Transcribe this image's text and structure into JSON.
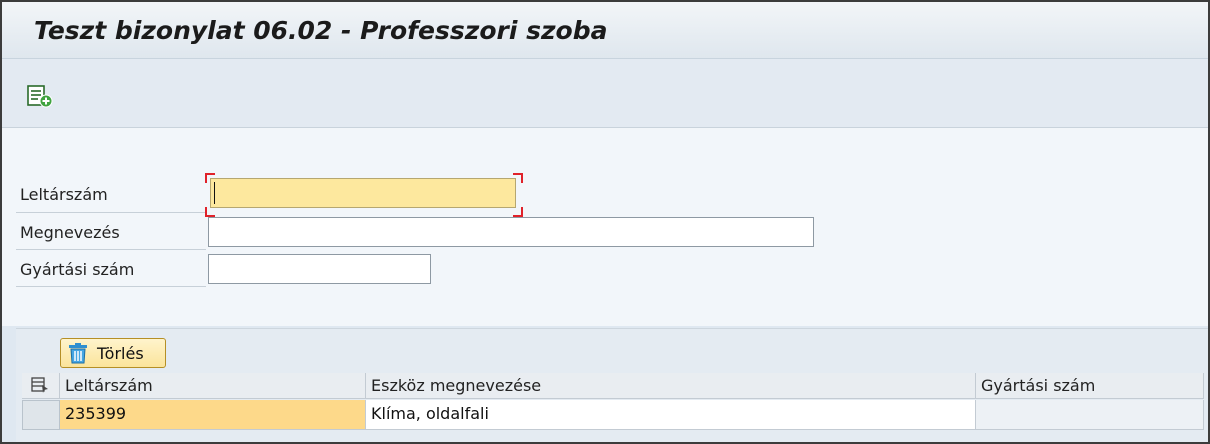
{
  "window": {
    "title": "Teszt bizonylat 06.02 - Professzori szoba"
  },
  "toolbar": {
    "icon": "add-row-icon"
  },
  "form": {
    "inventory_label": "Leltárszám",
    "inventory_value": "",
    "name_label": "Megnevezés",
    "name_value": "",
    "serial_label": "Gyártási szám",
    "serial_value": ""
  },
  "table": {
    "delete_button_label": "Törlés",
    "delete_icon": "trash-icon",
    "columns": [
      "Leltárszám",
      "Eszköz megnevezése",
      "Gyártási szám"
    ],
    "rows": [
      [
        "235399",
        "Klíma, oldalfali",
        ""
      ]
    ]
  },
  "colors": {
    "focused_field": "#fde89e",
    "button_bg": "#fbe49b",
    "selected_cell": "#fdd98a",
    "focus_marker": "#e0222a"
  }
}
